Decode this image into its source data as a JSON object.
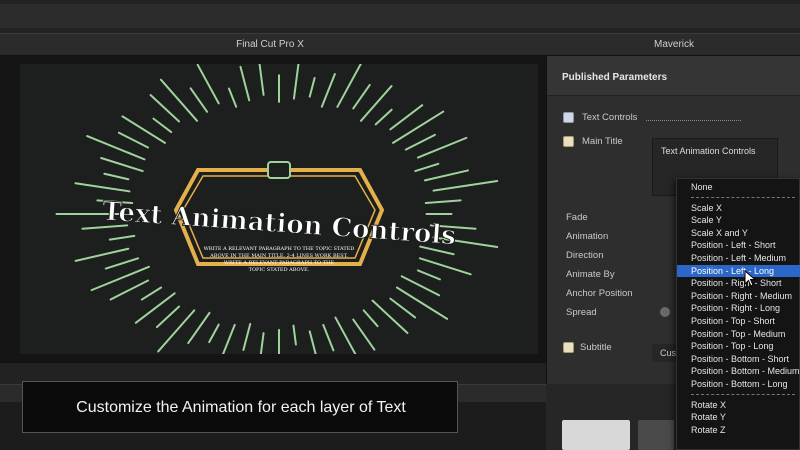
{
  "window": {
    "app_title": "Final Cut Pro X",
    "project_title": "Maverick"
  },
  "viewer": {
    "title_text": "Text Animation Controls",
    "body_lines": [
      "WRITE A RELEVANT PARAGRAPH TO THE TOPIC STATED",
      "ABOVE IN THE MAIN TITLE. 2-4 LINES WORK BEST.",
      "WRITE A RELEVANT PARAGRAPH TO THE",
      "TOPIC STATED ABOVE."
    ],
    "colors": {
      "ray": "#9fd39b",
      "hexagon": "#e3b04b",
      "title": "#ffffff"
    }
  },
  "inspector": {
    "header": "Published Parameters",
    "text_controls_label": "Text Controls",
    "main_title_label": "Main Title",
    "popup_label": "Text Animation Controls",
    "params": [
      "Fade",
      "Animation",
      "Direction",
      "Animate By",
      "Anchor Position",
      "Spread"
    ],
    "subtitle_label": "Subtitle",
    "subtitle_popup_value": "Cus"
  },
  "menu": {
    "items_group1": [
      "None"
    ],
    "items_group2": [
      "Scale X",
      "Scale Y",
      "Scale X and Y",
      "Position - Left - Short",
      "Position - Left - Medium",
      "Position - Left - Long",
      "Position - Right - Short",
      "Position - Right - Medium",
      "Position - Right - Long",
      "Position - Top - Short",
      "Position - Top - Medium",
      "Position - Top - Long",
      "Position - Bottom - Short",
      "Position - Bottom - Medium",
      "Position - Bottom - Long"
    ],
    "items_group3": [
      "Rotate X",
      "Rotate Y",
      "Rotate Z"
    ],
    "selected": "Position - Left - Long",
    "accent": "#2a67c8"
  },
  "caption": {
    "text": "Customize the Animation for each layer of Text"
  }
}
